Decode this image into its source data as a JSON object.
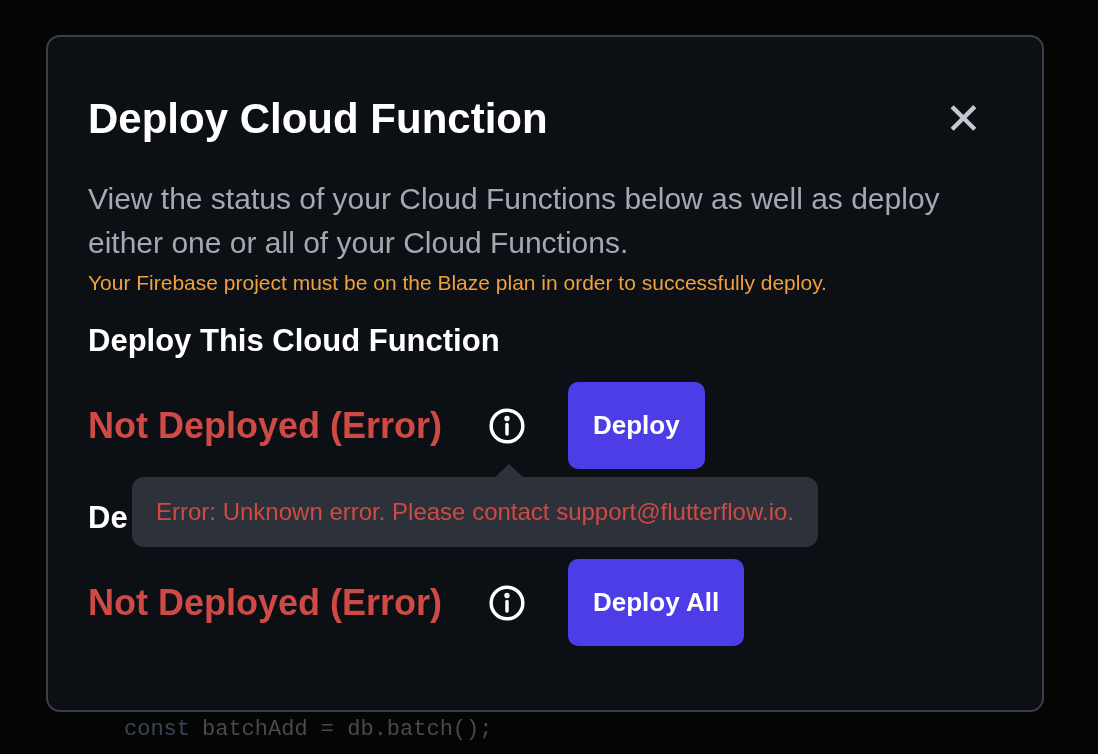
{
  "dialog": {
    "title": "Deploy Cloud Function",
    "close_label": "✕",
    "description": "View the status of your Cloud Functions below as well as deploy either one or all of your Cloud Functions.",
    "warning": "Your Firebase project must be on the Blaze plan in order to successfully deploy."
  },
  "sections": [
    {
      "heading": "Deploy This Cloud Function",
      "status": "Not Deployed (Error)",
      "button": "Deploy",
      "tooltip": "Error: Unknown error. Please contact support@flutterflow.io."
    },
    {
      "heading": "De",
      "status": "Not Deployed (Error)",
      "button": "Deploy All"
    }
  ],
  "code_line": {
    "keyword": "const",
    "rest": "batchAdd = db.batch();"
  }
}
